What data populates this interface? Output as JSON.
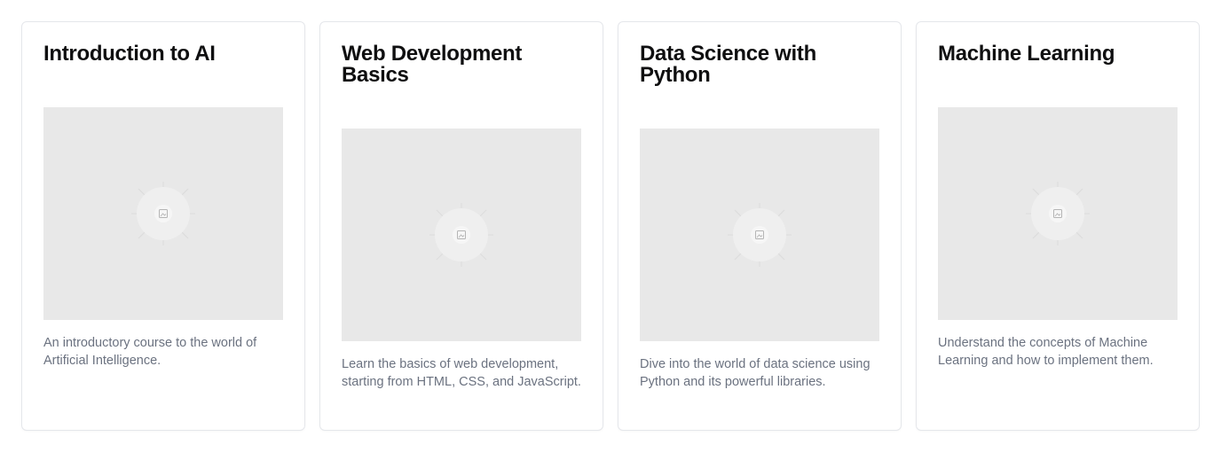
{
  "courses": [
    {
      "title": "Introduction to AI",
      "image_icon": "image-placeholder-icon",
      "description": "An introductory course to the world of Artificial Intelligence."
    },
    {
      "title": "Web Development Basics",
      "image_icon": "image-placeholder-icon",
      "description": "Learn the basics of web development, starting from HTML, CSS, and JavaScript."
    },
    {
      "title": "Data Science with Python",
      "image_icon": "image-placeholder-icon",
      "description": "Dive into the world of data science using Python and its powerful libraries."
    },
    {
      "title": "Machine Learning",
      "image_icon": "image-placeholder-icon",
      "description": "Understand the concepts of Machine Learning and how to implement them."
    }
  ],
  "colors": {
    "card_border": "#e5e7eb",
    "title": "#0f0f10",
    "description": "#6b7280",
    "image_bg": "#e8e8e8"
  }
}
